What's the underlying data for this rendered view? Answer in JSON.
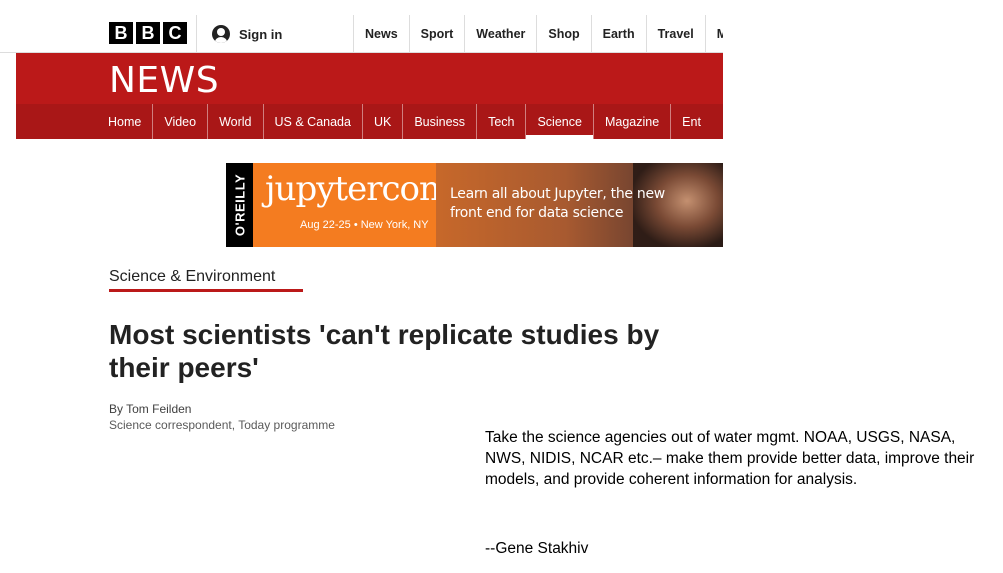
{
  "header": {
    "logo_letters": [
      "B",
      "B",
      "C"
    ],
    "sign_in": "Sign in",
    "top_links": [
      "News",
      "Sport",
      "Weather",
      "Shop",
      "Earth",
      "Travel",
      "M"
    ]
  },
  "news_banner": {
    "title": "NEWS",
    "nav": [
      "Home",
      "Video",
      "World",
      "US & Canada",
      "UK",
      "Business",
      "Tech",
      "Science",
      "Magazine",
      "Ent"
    ],
    "active": "Science"
  },
  "advert": {
    "brand": "O'REILLY",
    "event": "jupytercon",
    "date": "Aug 22-25 • New York, NY",
    "tagline": "Learn all about Jupyter, the new front end for data science"
  },
  "article": {
    "section": "Science & Environment",
    "headline": "Most scientists 'can't replicate studies by their peers'",
    "author": "By Tom Feilden",
    "author_role": "Science correspondent, Today programme"
  },
  "quote": {
    "text": "Take the science agencies out of water mgmt. NOAA, USGS, NASA, NWS, NIDIS, NCAR etc.– make them provide better data, improve their models, and provide coherent information for analysis.",
    "signature": "--Gene Stakhiv"
  },
  "colors": {
    "bbc_red": "#bb1919",
    "nav_red": "#a91717",
    "ad_orange": "#f47c20"
  }
}
